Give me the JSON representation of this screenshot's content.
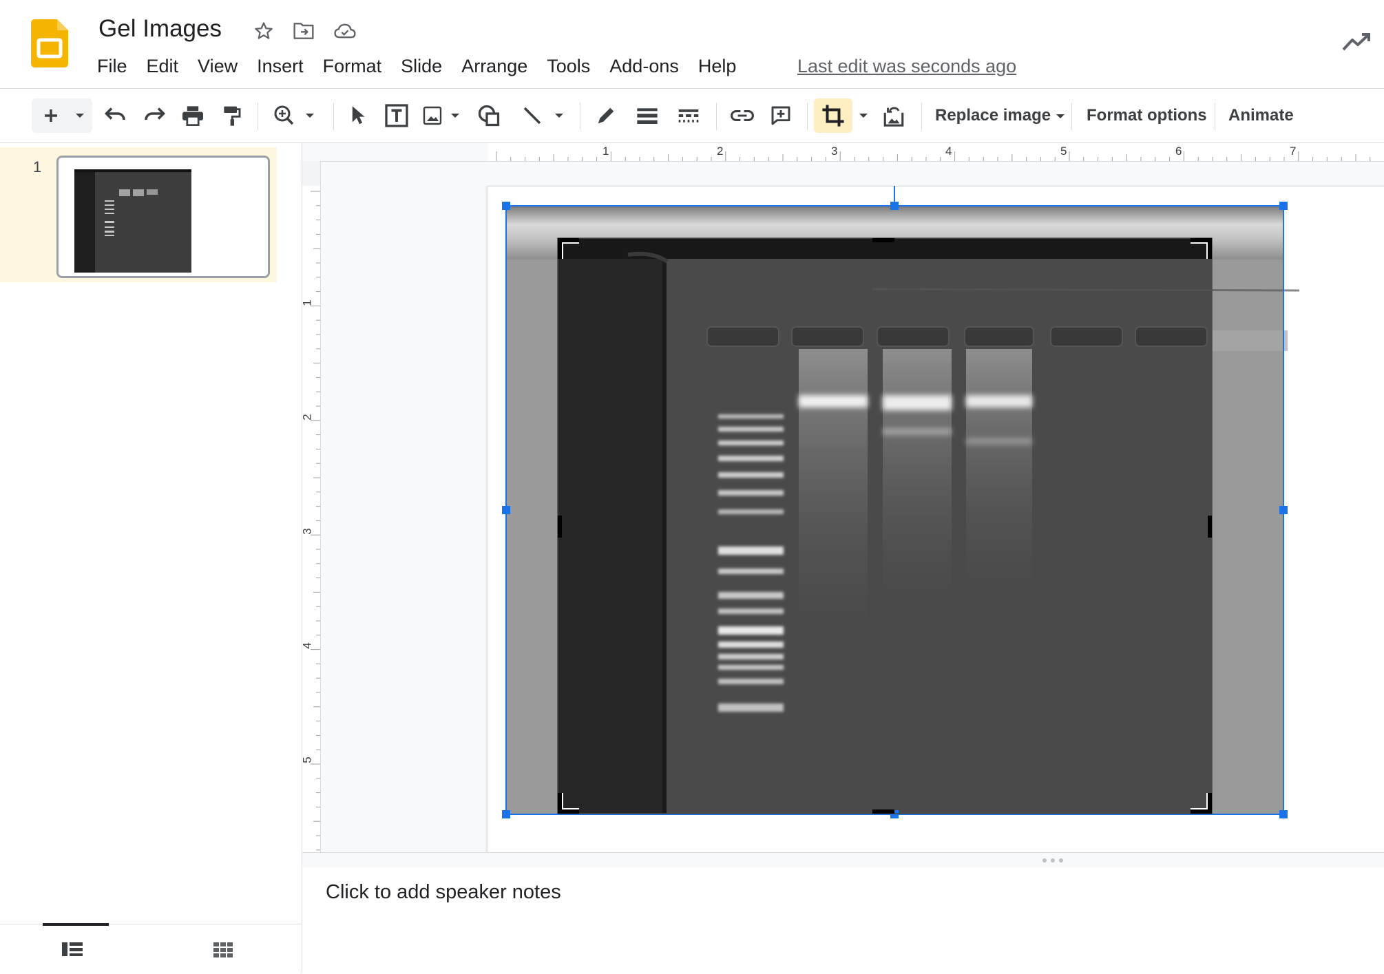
{
  "app": {
    "doc_title": "Gel Images",
    "last_edit": "Last edit was seconds ago"
  },
  "menu": [
    "File",
    "Edit",
    "View",
    "Insert",
    "Format",
    "Slide",
    "Arrange",
    "Tools",
    "Add-ons",
    "Help"
  ],
  "toolbar": {
    "replace_image": "Replace image",
    "format_options": "Format options",
    "animate": "Animate"
  },
  "filmstrip": {
    "slides": [
      {
        "number": "1"
      }
    ]
  },
  "ruler": {
    "horizontal_labels": [
      "1",
      "2",
      "3",
      "4",
      "5",
      "6",
      "7"
    ],
    "vertical_labels": [
      "1",
      "2",
      "3",
      "4",
      "5"
    ]
  },
  "notes": {
    "placeholder": "Click to add speaker notes"
  },
  "colors": {
    "accent_blue": "#1a73e8",
    "slides_yellow": "#f4b400",
    "selected_slide_bg": "#fef7e0",
    "crop_active_bg": "#feefc3"
  },
  "icons": [
    "slides-logo-icon",
    "star-icon",
    "move-to-folder-icon",
    "cloud-saved-icon",
    "activity-trend-icon"
  ]
}
